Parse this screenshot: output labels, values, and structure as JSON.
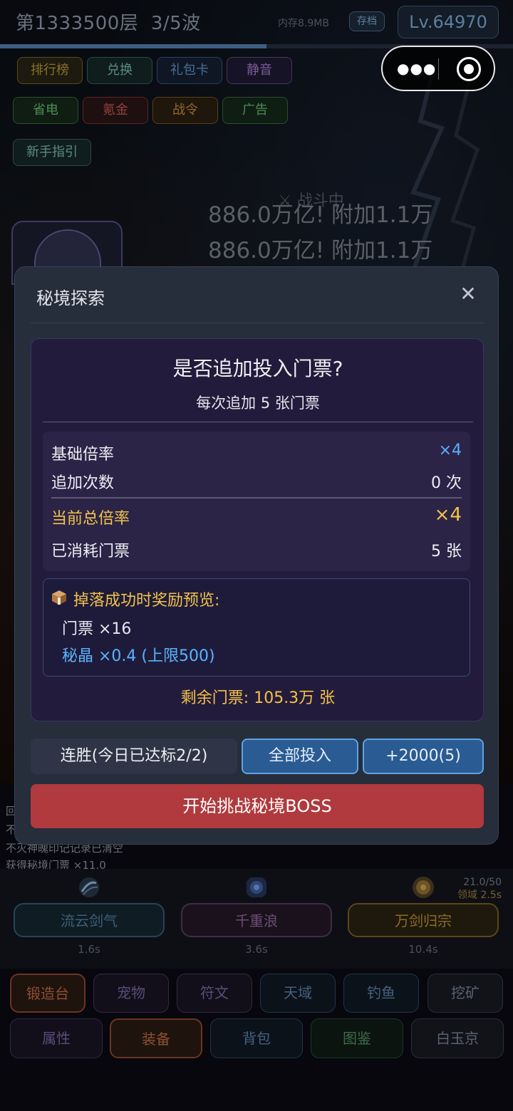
{
  "topbar": {
    "floor": "第1333500层",
    "wave": "3/5波",
    "memory": "内存8.9MB",
    "save_label": "存档",
    "level": "Lv.64970",
    "progress": 0.52
  },
  "menu_row1": [
    "排行榜",
    "兑换",
    "礼包卡",
    "静音"
  ],
  "menu_row2": [
    "省电",
    "氪金",
    "战令",
    "广告"
  ],
  "menu_row3": [
    "新手指引"
  ],
  "battle": {
    "status": "战斗中",
    "damage_lines": [
      "886.0万亿! 附加1.1万",
      "886.0万亿! 附加1.1万"
    ]
  },
  "modal": {
    "title": "秘境探索",
    "close_glyph": "✕",
    "question": "是否追加投入门票?",
    "subtitle": "每次追加 5 张门票",
    "stats": [
      {
        "label": "基础倍率",
        "value": "×4"
      },
      {
        "label": "追加次数",
        "value": "0 次"
      },
      {
        "label": "当前总倍率",
        "value": "×4"
      },
      {
        "label": "已消耗门票",
        "value": "5 张"
      }
    ],
    "preview_title": "掉落成功时奖励预览:",
    "preview_ticket": "门票 ×16",
    "preview_crystal": "秘晶 ×0.4 (上限500)",
    "remaining": "剩余门票: 105.3万 张",
    "streak_label": "连胜(今日已达标2/2)",
    "all_in_label": "全部投入",
    "add_label": "+2000(5)",
    "start_label": "开始挑战秘境BOSS"
  },
  "logs": [
    "回",
    "不",
    "不灭神魄印记记录已清空",
    "获得秘境门票 ×11.0"
  ],
  "skills": [
    {
      "name": "流云剑气",
      "cd": "1.6s"
    },
    {
      "name": "千重浪",
      "cd": "3.6s"
    },
    {
      "name": "万剑归宗",
      "cd": "10.4s"
    }
  ],
  "skill_counter": {
    "count": "21.0/50",
    "domain": "领域 2.5s"
  },
  "nav_row1": [
    "锻造台",
    "宠物",
    "符文",
    "天域",
    "钓鱼",
    "挖矿"
  ],
  "nav_row2": [
    "属性",
    "装备",
    "背包",
    "图鉴",
    "白玉京"
  ],
  "colors": {
    "accent_gold": "#f3c24a",
    "accent_blue": "#59b3ff",
    "start_button": "#b03a3d",
    "modal_bg": "#262d3b",
    "inner_bg": "#221b3b"
  },
  "icons": {
    "capsule_more": "more-dots-icon",
    "capsule_close": "target-circle-icon",
    "preview": "package-box-icon"
  }
}
